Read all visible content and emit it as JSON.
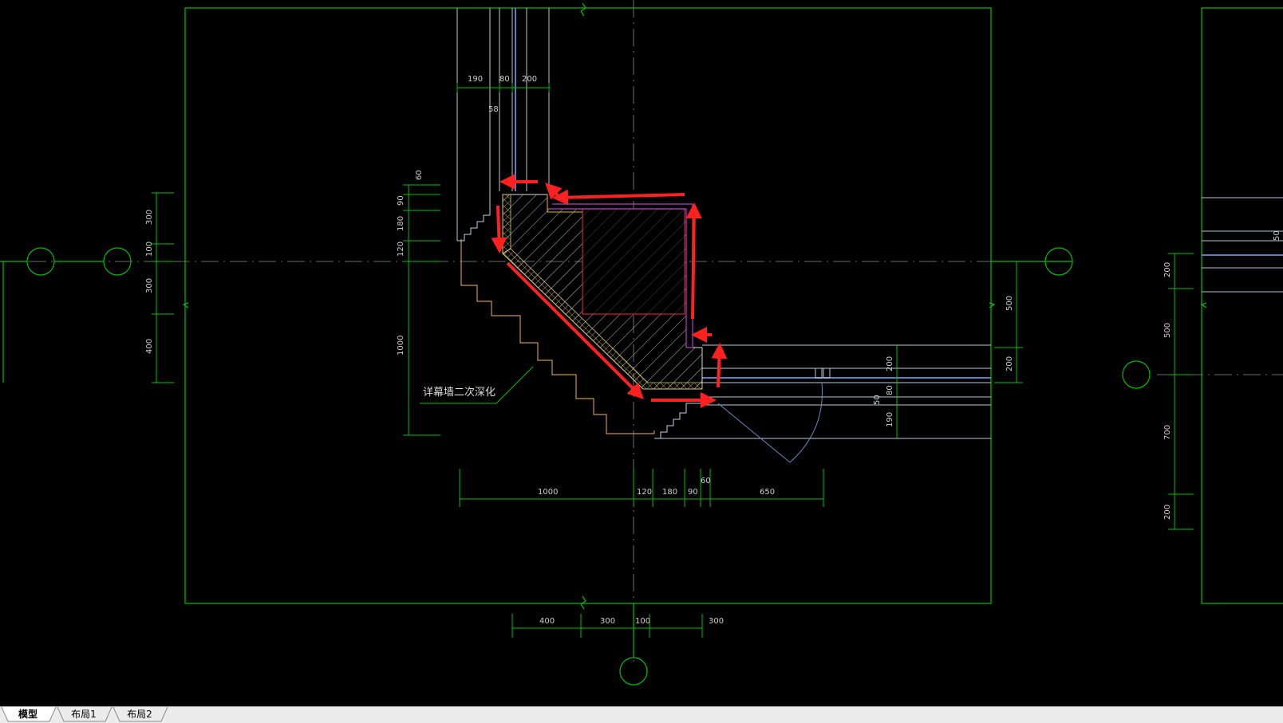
{
  "drawing": {
    "note": "详幕墙二次深化",
    "top_dims": [
      "190",
      "80",
      "200",
      "58"
    ],
    "left_dims_small": [
      "60",
      "90",
      "180",
      "120",
      "1000"
    ],
    "left_frame_dims": [
      "300",
      "100",
      "300",
      "400"
    ],
    "right_frame_dims": [
      "500",
      "200"
    ],
    "right_inner_dims": [
      "200",
      "80",
      "50",
      "190"
    ],
    "bottom_dims": [
      "1000",
      "120",
      "180",
      "90",
      "60",
      "650"
    ],
    "bottom_frame_dims": [
      "400",
      "300",
      "100",
      "300"
    ],
    "right_panel_dims": [
      "50",
      "200",
      "500",
      "700",
      "200"
    ]
  },
  "colors": {
    "background": "#000000",
    "frame": "#00c000",
    "axis": "#9a9a9a",
    "annotation": "#ff2020",
    "wall_outline": "#c89640",
    "concrete": "#d0d0d0",
    "purple": "#b040c0"
  },
  "tabs": [
    {
      "label": "模型",
      "active": true
    },
    {
      "label": "布局1",
      "active": false
    },
    {
      "label": "布局2",
      "active": false
    }
  ]
}
